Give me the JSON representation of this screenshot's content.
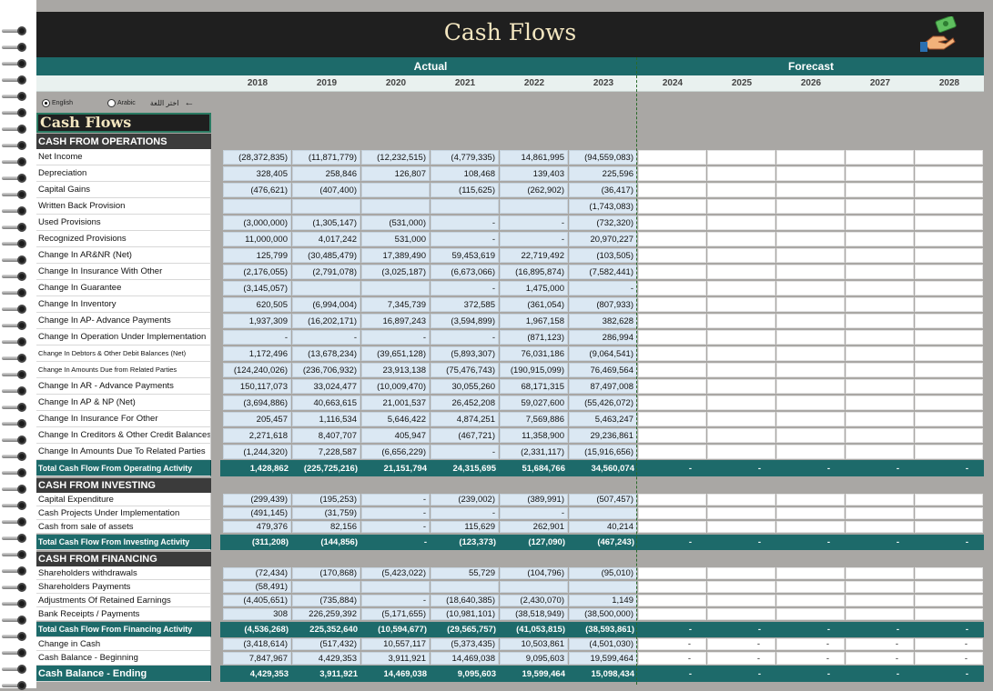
{
  "title": "Cash Flows",
  "actual_label": "Actual",
  "forecast_label": "Forecast",
  "years": [
    "2018",
    "2019",
    "2020",
    "2021",
    "2022",
    "2023",
    "2024",
    "2025",
    "2026",
    "2027",
    "2028"
  ],
  "lang": {
    "english": "English",
    "arabic": "Arabic",
    "choose": "اختر اللغة"
  },
  "sheet_title": "Cash Flows",
  "sections": {
    "ops": "CASH FROM OPERATIONS",
    "inv": "CASH FROM INVESTING",
    "fin": "CASH FROM FINANCING"
  },
  "ops_rows": [
    {
      "label": "Net Income",
      "v": [
        "(28,372,835)",
        "(11,871,779)",
        "(12,232,515)",
        "(4,779,335)",
        "14,861,995",
        "(94,559,083)"
      ]
    },
    {
      "label": "Depreciation",
      "v": [
        "328,405",
        "258,846",
        "126,807",
        "108,468",
        "139,403",
        "225,596"
      ]
    },
    {
      "label": "Capital Gains",
      "v": [
        "(476,621)",
        "(407,400)",
        "",
        "(115,625)",
        "(262,902)",
        "(36,417)"
      ]
    },
    {
      "label": "Written Back Provision",
      "v": [
        "",
        "",
        "",
        "",
        "",
        "(1,743,083)"
      ]
    },
    {
      "label": "Used Provisions",
      "v": [
        "(3,000,000)",
        "(1,305,147)",
        "(531,000)",
        "-",
        "-",
        "(732,320)"
      ]
    },
    {
      "label": "Recognized Provisions",
      "v": [
        "11,000,000",
        "4,017,242",
        "531,000",
        "-",
        "-",
        "20,970,227"
      ]
    },
    {
      "label": "Change In AR&NR (Net)",
      "v": [
        "125,799",
        "(30,485,479)",
        "17,389,490",
        "59,453,619",
        "22,719,492",
        "(103,505)"
      ]
    },
    {
      "label": "Change In Insurance With Other",
      "v": [
        "(2,176,055)",
        "(2,791,078)",
        "(3,025,187)",
        "(6,673,066)",
        "(16,895,874)",
        "(7,582,441)"
      ]
    },
    {
      "label": "Change In Guarantee",
      "v": [
        "(3,145,057)",
        "",
        "",
        "-",
        "1,475,000",
        "-"
      ]
    },
    {
      "label": "Change In Inventory",
      "v": [
        "620,505",
        "(6,994,004)",
        "7,345,739",
        "372,585",
        "(361,054)",
        "(807,933)"
      ]
    },
    {
      "label": "Change In AP- Advance Payments",
      "v": [
        "1,937,309",
        "(16,202,171)",
        "16,897,243",
        "(3,594,899)",
        "1,967,158",
        "382,628"
      ]
    },
    {
      "label": "Change In Operation Under Implementation",
      "v": [
        "-",
        "-",
        "-",
        "-",
        "(871,123)",
        "286,994"
      ]
    },
    {
      "label": "Change In Debtors & Other Debit Balances (Net)",
      "v": [
        "1,172,496",
        "(13,678,234)",
        "(39,651,128)",
        "(5,893,307)",
        "76,031,186",
        "(9,064,541)"
      ],
      "small": true
    },
    {
      "label": "Change In Amounts Due from Related Parties",
      "v": [
        "(124,240,026)",
        "(236,706,932)",
        "23,913,138",
        "(75,476,743)",
        "(190,915,099)",
        "76,469,564"
      ],
      "small": true
    },
    {
      "label": "Change In AR - Advance Payments",
      "v": [
        "150,117,073",
        "33,024,477",
        "(10,009,470)",
        "30,055,260",
        "68,171,315",
        "87,497,008"
      ]
    },
    {
      "label": "Change In AP & NP (Net)",
      "v": [
        "(3,694,886)",
        "40,663,615",
        "21,001,537",
        "26,452,208",
        "59,027,600",
        "(55,426,072)"
      ]
    },
    {
      "label": "Change In Insurance For Other",
      "v": [
        "205,457",
        "1,116,534",
        "5,646,422",
        "4,874,251",
        "7,569,886",
        "5,463,247"
      ]
    },
    {
      "label": "Change In Creditors & Other Credit Balances",
      "v": [
        "2,271,618",
        "8,407,707",
        "405,947",
        "(467,721)",
        "11,358,900",
        "29,236,861"
      ]
    },
    {
      "label": "Change In Amounts Due To Related Parties",
      "v": [
        "(1,244,320)",
        "7,228,587",
        "(6,656,229)",
        "-",
        "(2,331,117)",
        "(15,916,656)"
      ]
    }
  ],
  "ops_total": {
    "label": "Total Cash Flow From Operating Activity",
    "v": [
      "1,428,862",
      "(225,725,216)",
      "21,151,794",
      "24,315,695",
      "51,684,766",
      "34,560,074"
    ],
    "f": [
      "-",
      "-",
      "-",
      "-",
      "-"
    ]
  },
  "inv_rows": [
    {
      "label": "Capital Expenditure",
      "v": [
        "(299,439)",
        "(195,253)",
        "-",
        "(239,002)",
        "(389,991)",
        "(507,457)"
      ]
    },
    {
      "label": "Cash Projects Under Implementation",
      "v": [
        "(491,145)",
        "(31,759)",
        "-",
        "-",
        "-",
        ""
      ]
    },
    {
      "label": "Cash from sale of assets",
      "v": [
        "479,376",
        "82,156",
        "-",
        "115,629",
        "262,901",
        "40,214"
      ]
    }
  ],
  "inv_total": {
    "label": "Total Cash Flow From Investing Activity",
    "v": [
      "(311,208)",
      "(144,856)",
      "-",
      "(123,373)",
      "(127,090)",
      "(467,243)"
    ],
    "f": [
      "-",
      "-",
      "-",
      "-",
      "-"
    ]
  },
  "fin_rows": [
    {
      "label": "Shareholders withdrawals",
      "v": [
        "(72,434)",
        "(170,868)",
        "(5,423,022)",
        "55,729",
        "(104,796)",
        "(95,010)"
      ]
    },
    {
      "label": "Shareholders Payments",
      "v": [
        "(58,491)",
        "",
        "",
        "",
        "",
        ""
      ]
    },
    {
      "label": "Adjustments Of Retained Earnings",
      "v": [
        "(4,405,651)",
        "(735,884)",
        "-",
        "(18,640,385)",
        "(2,430,070)",
        "1,149"
      ]
    },
    {
      "label": "Bank Receipts / Payments",
      "v": [
        "308",
        "226,259,392",
        "(5,171,655)",
        "(10,981,101)",
        "(38,518,949)",
        "(38,500,000)"
      ]
    }
  ],
  "fin_total": {
    "label": "Total Cash Flow From Financing Activity",
    "v": [
      "(4,536,268)",
      "225,352,640",
      "(10,594,677)",
      "(29,565,757)",
      "(41,053,815)",
      "(38,593,861)"
    ],
    "f": [
      "-",
      "-",
      "-",
      "-",
      "-"
    ]
  },
  "change": {
    "label": "Change in Cash",
    "v": [
      "(3,418,614)",
      "(517,432)",
      "10,557,117",
      "(5,373,435)",
      "10,503,861",
      "(4,501,030)"
    ],
    "f": [
      "-",
      "-",
      "-",
      "-",
      "-"
    ]
  },
  "begin": {
    "label": "Cash Balance - Beginning",
    "v": [
      "7,847,967",
      "4,429,353",
      "3,911,921",
      "14,469,038",
      "9,095,603",
      "19,599,464"
    ],
    "f": [
      "-",
      "-",
      "-",
      "-",
      "-"
    ]
  },
  "end": {
    "label": "Cash Balance - Ending",
    "v": [
      "4,429,353",
      "3,911,921",
      "14,469,038",
      "9,095,603",
      "19,599,464",
      "15,098,434"
    ],
    "f": [
      "-",
      "-",
      "-",
      "-",
      "-"
    ]
  },
  "colors": {
    "teal": "#1d6a6a",
    "dark": "#1f1f1f",
    "cream": "#f3e6c0",
    "cell": "#dbe8f3"
  }
}
